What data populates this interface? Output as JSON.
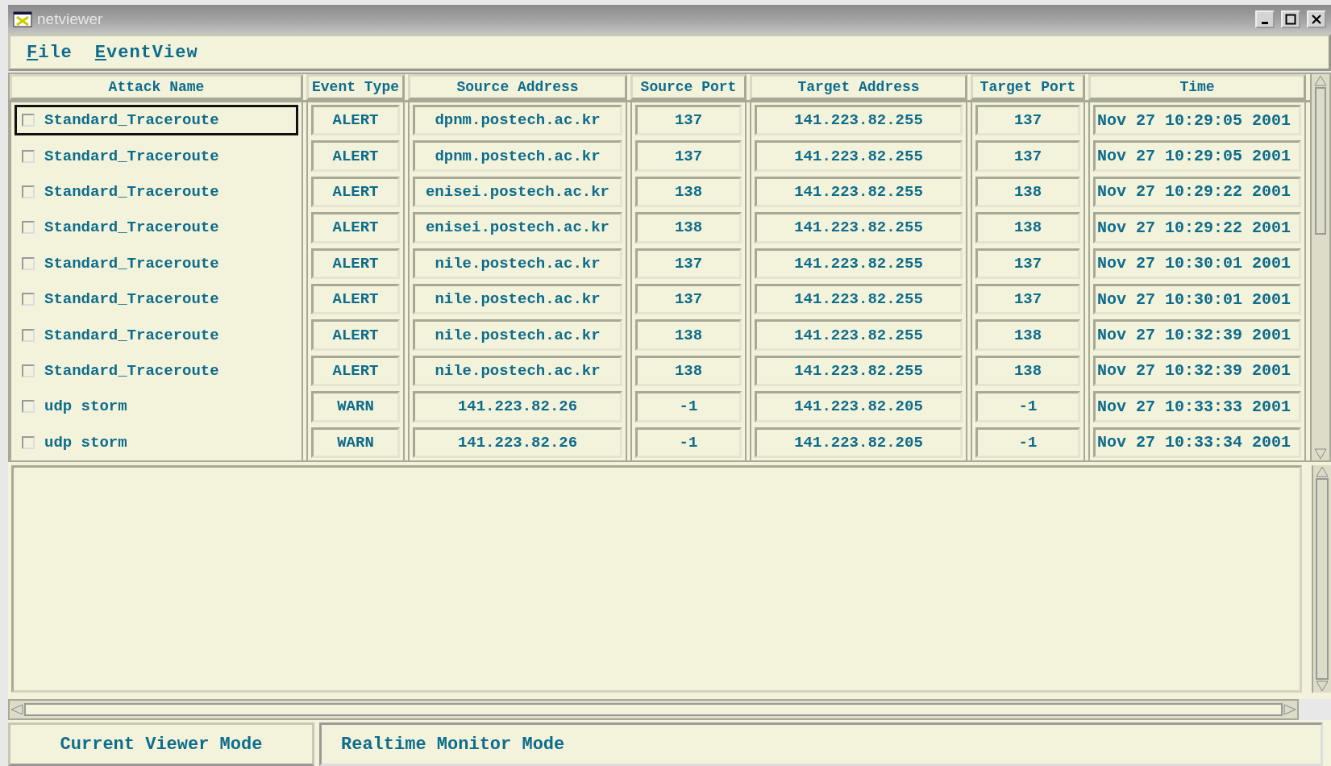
{
  "window": {
    "title": "netviewer"
  },
  "menu": [
    {
      "label": "File"
    },
    {
      "label": "EventView"
    }
  ],
  "table": {
    "columns": [
      "Attack Name",
      "Event Type",
      "Source Address",
      "Source Port",
      "Target Address",
      "Target Port",
      "Time"
    ],
    "rows": [
      {
        "selected": true,
        "checked": false,
        "cells": [
          "Standard_Traceroute",
          "ALERT",
          "dpnm.postech.ac.kr",
          "137",
          "141.223.82.255",
          "137",
          "Nov 27 10:29:05 2001"
        ]
      },
      {
        "selected": false,
        "checked": false,
        "cells": [
          "Standard_Traceroute",
          "ALERT",
          "dpnm.postech.ac.kr",
          "137",
          "141.223.82.255",
          "137",
          "Nov 27 10:29:05 2001"
        ]
      },
      {
        "selected": false,
        "checked": false,
        "cells": [
          "Standard_Traceroute",
          "ALERT",
          "enisei.postech.ac.kr",
          "138",
          "141.223.82.255",
          "138",
          "Nov 27 10:29:22 2001"
        ]
      },
      {
        "selected": false,
        "checked": false,
        "cells": [
          "Standard_Traceroute",
          "ALERT",
          "enisei.postech.ac.kr",
          "138",
          "141.223.82.255",
          "138",
          "Nov 27 10:29:22 2001"
        ]
      },
      {
        "selected": false,
        "checked": false,
        "cells": [
          "Standard_Traceroute",
          "ALERT",
          "nile.postech.ac.kr",
          "137",
          "141.223.82.255",
          "137",
          "Nov 27 10:30:01 2001"
        ]
      },
      {
        "selected": false,
        "checked": false,
        "cells": [
          "Standard_Traceroute",
          "ALERT",
          "nile.postech.ac.kr",
          "137",
          "141.223.82.255",
          "137",
          "Nov 27 10:30:01 2001"
        ]
      },
      {
        "selected": false,
        "checked": false,
        "cells": [
          "Standard_Traceroute",
          "ALERT",
          "nile.postech.ac.kr",
          "138",
          "141.223.82.255",
          "138",
          "Nov 27 10:32:39 2001"
        ]
      },
      {
        "selected": false,
        "checked": false,
        "cells": [
          "Standard_Traceroute",
          "ALERT",
          "nile.postech.ac.kr",
          "138",
          "141.223.82.255",
          "138",
          "Nov 27 10:32:39 2001"
        ]
      },
      {
        "selected": false,
        "checked": false,
        "cells": [
          "udp storm",
          "WARN",
          "141.223.82.26",
          "-1",
          "141.223.82.205",
          "-1",
          "Nov 27 10:33:33 2001"
        ]
      },
      {
        "selected": false,
        "checked": false,
        "cells": [
          "udp storm",
          "WARN",
          "141.223.82.26",
          "-1",
          "141.223.82.205",
          "-1",
          "Nov 27 10:33:34 2001"
        ]
      }
    ]
  },
  "status_bar": {
    "label": "Current Viewer Mode",
    "value": "Realtime Monitor Mode"
  }
}
